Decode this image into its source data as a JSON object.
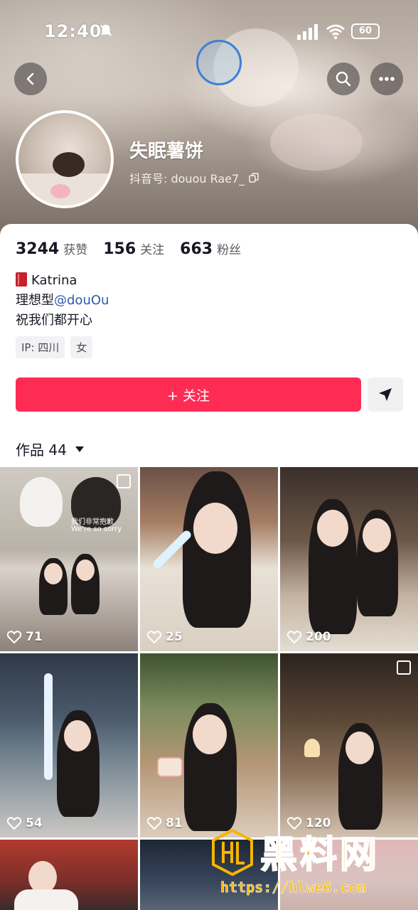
{
  "status_bar": {
    "time": "12:40",
    "battery": "60"
  },
  "profile": {
    "nickname": "失眠薯饼",
    "douyin_id": "抖音号: douou Rae7_"
  },
  "stats": [
    {
      "num": "3244",
      "label": "获赞"
    },
    {
      "num": "156",
      "label": "关注"
    },
    {
      "num": "663",
      "label": "粉丝"
    }
  ],
  "bio": {
    "line1": "Katrina",
    "line2_prefix": "理想型",
    "line2_mention": "@douOu",
    "line3": "祝我们都开心"
  },
  "tags": [
    "IP: 四川",
    "女"
  ],
  "actions": {
    "follow_label": "+ 关注"
  },
  "tabs": {
    "works_label": "作品 44"
  },
  "grid": [
    {
      "likes": "71",
      "caption1": "我们非常抱歉",
      "caption2": "We're so sorry",
      "multi": true
    },
    {
      "likes": "25",
      "multi": false
    },
    {
      "likes": "200",
      "multi": false
    },
    {
      "likes": "54",
      "multi": false
    },
    {
      "likes": "81",
      "multi": false
    },
    {
      "likes": "120",
      "multi": true
    }
  ],
  "watermark": {
    "text": "黑料网",
    "url": "https://hlwe6.com"
  },
  "colors": {
    "follow": "#fe2c55",
    "mention": "#2f5aa8",
    "watermark": "#f6b500"
  }
}
